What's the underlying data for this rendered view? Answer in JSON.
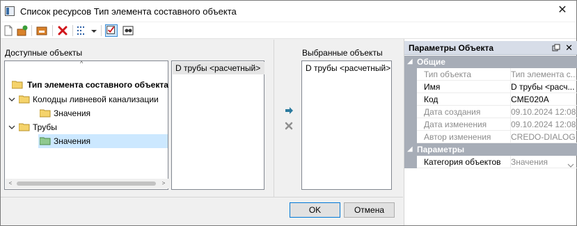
{
  "window": {
    "title": "Список ресурсов Тип элемента составного объекта"
  },
  "toolbar": {
    "buttons": [
      "new-icon",
      "add-icon",
      "import-icon",
      "delete-icon",
      "dotted-list-icon",
      "dropdown-arrow-icon",
      "checkbox-checked-icon",
      "find-icon"
    ]
  },
  "available": {
    "label": "Доступные объекты",
    "tree": {
      "root": "Тип элемента составного объекта",
      "items": [
        {
          "label": "Колодцы ливневой канализации"
        },
        {
          "label": "Значения"
        },
        {
          "label": "Трубы"
        },
        {
          "label": "Значения"
        }
      ]
    },
    "list_header": "D трубы <расчетный>"
  },
  "selected": {
    "label": "Выбранные объекты",
    "items": [
      "D трубы <расчетный>"
    ]
  },
  "buttons": {
    "ok": "OK",
    "cancel": "Отмена"
  },
  "properties": {
    "title": "Параметры Объекта",
    "categories": [
      {
        "name": "Общие",
        "rows": [
          {
            "key": "Тип объекта",
            "value": "Тип элемента с...",
            "readonly": true
          },
          {
            "key": "Имя",
            "value": "D трубы <расч...",
            "readonly": false
          },
          {
            "key": "Код",
            "value": "CME020A",
            "readonly": false
          },
          {
            "key": "Дата создания",
            "value": "09.10.2024 12:08",
            "readonly": true
          },
          {
            "key": "Дата изменения",
            "value": "09.10.2024 12:08",
            "readonly": true
          },
          {
            "key": "Автор изменения",
            "value": "CREDO-DIALOG...",
            "readonly": true
          }
        ]
      },
      {
        "name": "Параметры",
        "rows": [
          {
            "key": "Категория объектов",
            "value": "Значения",
            "readonly": false
          }
        ]
      }
    ]
  },
  "colors": {
    "selection": "#cce8ff",
    "category_bg": "#a7adb7",
    "accent": "#0078d7",
    "delete_red": "#d0141a",
    "folder_yellow": "#f5d36b",
    "folder_green": "#8fc98f",
    "arrow_teal": "#2b7a9e"
  }
}
